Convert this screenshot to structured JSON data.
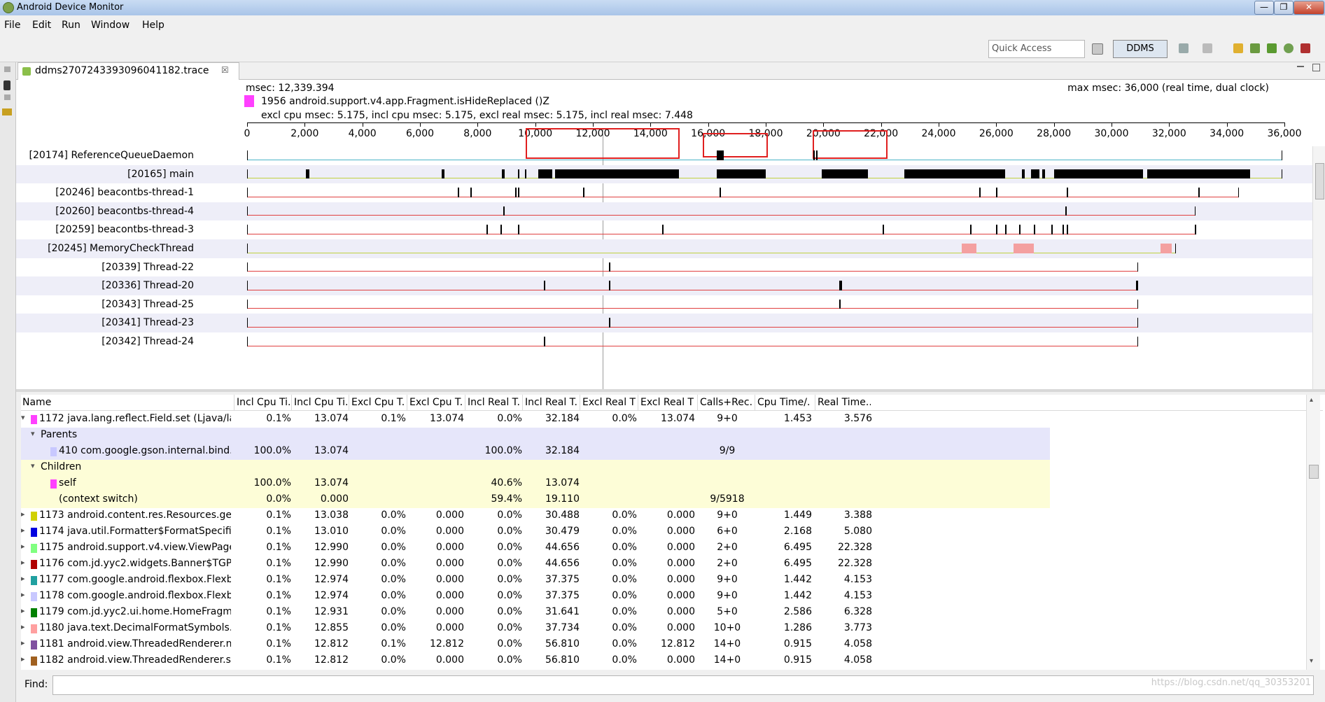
{
  "window": {
    "title": "Android Device Monitor",
    "controls": {
      "minimize": "—",
      "maximize": "❐",
      "close": "✕"
    }
  },
  "menu": [
    "File",
    "Edit",
    "Run",
    "Window",
    "Help"
  ],
  "toolbar": {
    "quick_access": "Quick Access",
    "perspective": "DDMS"
  },
  "tab": {
    "label": "ddms2707243393096041182.trace",
    "close": "☒"
  },
  "timeline": {
    "msec": "msec: 12,339.394",
    "max_msec": "max msec: 36,000 (real time, dual clock)",
    "method": "1956 android.support.v4.app.Fragment.isHideReplaced ()Z",
    "method_color": "#ff40ff",
    "detail": "excl cpu msec: 5.175, incl cpu msec: 5.175, excl real msec: 5.175, incl real msec: 7.448",
    "axis": {
      "range": [
        0,
        36000
      ],
      "ticks": [
        "0",
        "2,000",
        "4,000",
        "6,000",
        "8,000",
        "10,000",
        "12,000",
        "14,000",
        "16,000",
        "18,000",
        "20,000",
        "22,000",
        "24,000",
        "26,000",
        "28,000",
        "30,000",
        "32,000",
        "34,000",
        "36,000"
      ]
    },
    "cursor_msec": 12339,
    "threads": [
      {
        "name": "[20174] ReferenceQueueDaemon",
        "start": 0,
        "end": 35900,
        "line_color": "#4ab4c8",
        "marks": [
          [
            16300,
            16550
          ],
          [
            19650,
            19700
          ],
          [
            19750,
            19800
          ]
        ]
      },
      {
        "name": "[20165] main",
        "start": 0,
        "end": 35900,
        "line_color": "#c0d040",
        "marks": [
          [
            2050,
            2150
          ],
          [
            6750,
            6850
          ],
          [
            8850,
            8950
          ],
          [
            9400,
            9450
          ],
          [
            9650,
            9700
          ],
          [
            10100,
            10600
          ],
          [
            10700,
            15000
          ],
          [
            16300,
            18000
          ],
          [
            19950,
            21550
          ],
          [
            22800,
            26300
          ],
          [
            26900,
            27000
          ],
          [
            27200,
            27500
          ],
          [
            27600,
            27700
          ],
          [
            28000,
            31100
          ],
          [
            31250,
            34800
          ]
        ]
      },
      {
        "name": "[20246] beacontbs-thread-1",
        "start": 0,
        "end": 34400,
        "line_color": "#e04040",
        "marks": [
          [
            7300,
            7350
          ],
          [
            7750,
            7800
          ],
          [
            9300,
            9350
          ],
          [
            9400,
            9450
          ],
          [
            11650,
            11700
          ],
          [
            16400,
            16450
          ],
          [
            25400,
            25450
          ],
          [
            26000,
            26050
          ],
          [
            28450,
            28500
          ],
          [
            33000,
            33050
          ]
        ]
      },
      {
        "name": "[20260] beacontbs-thread-4",
        "start": 0,
        "end": 32900,
        "line_color": "#e04040",
        "marks": [
          [
            8900,
            8950
          ],
          [
            28400,
            28450
          ]
        ]
      },
      {
        "name": "[20259] beacontbs-thread-3",
        "start": 0,
        "end": 32900,
        "line_color": "#e04040",
        "marks": [
          [
            8300,
            8350
          ],
          [
            8800,
            8850
          ],
          [
            9400,
            9450
          ],
          [
            14400,
            14450
          ],
          [
            22050,
            22100
          ],
          [
            25100,
            25150
          ],
          [
            26000,
            26050
          ],
          [
            26300,
            26350
          ],
          [
            26800,
            26850
          ],
          [
            27300,
            27350
          ],
          [
            27900,
            27950
          ],
          [
            28300,
            28350
          ],
          [
            28450,
            28500
          ],
          [
            32900,
            32950
          ]
        ]
      },
      {
        "name": "[20245] MemoryCheckThread",
        "start": 0,
        "end": 32200,
        "line_color": "#c0d040",
        "marks": [
          [
            24800,
            25300
          ],
          [
            26600,
            27300
          ],
          [
            31700,
            32100
          ]
        ]
      },
      {
        "name": "[20339] Thread-22",
        "start": 0,
        "end": 30900,
        "line_color": "#e04040",
        "marks": [
          [
            12550,
            12600
          ]
        ]
      },
      {
        "name": "[20336] Thread-20",
        "start": 0,
        "end": 30900,
        "line_color": "#e04040",
        "marks": [
          [
            10300,
            10350
          ],
          [
            12550,
            12600
          ],
          [
            20550,
            20650
          ],
          [
            30850,
            30900
          ]
        ]
      },
      {
        "name": "[20343] Thread-25",
        "start": 0,
        "end": 30900,
        "line_color": "#e04040",
        "marks": [
          [
            20550,
            20600
          ]
        ]
      },
      {
        "name": "[20341] Thread-23",
        "start": 0,
        "end": 30900,
        "line_color": "#e04040",
        "marks": [
          [
            12550,
            12600
          ]
        ]
      },
      {
        "name": "[20342] Thread-24",
        "start": 0,
        "end": 30900,
        "line_color": "#e04040",
        "marks": [
          [
            10300,
            10350
          ]
        ]
      }
    ]
  },
  "table": {
    "columns": [
      "Name",
      "Incl Cpu Ti...",
      "Incl Cpu Ti...",
      "Excl Cpu T...",
      "Excl Cpu T...",
      "Incl Real T...",
      "Incl Real T...",
      "Excl Real T...",
      "Excl Real T...",
      "Calls+Rec...",
      "Cpu Time/...",
      "Real Time..."
    ],
    "rows": [
      {
        "kind": "method",
        "twist": "▾",
        "color": "#ff40ff",
        "cells": [
          "1172 java.lang.reflect.Field.set (Ljava/lang/Obj",
          "0.1%",
          "13.074",
          "0.1%",
          "13.074",
          "0.0%",
          "32.184",
          "0.0%",
          "13.074",
          "9+0",
          "1.453",
          "3.576"
        ]
      },
      {
        "kind": "parents",
        "twist": "▾",
        "color": "",
        "cells": [
          "Parents",
          "",
          "",
          "",
          "",
          "",
          "",
          "",
          "",
          "",
          "",
          ""
        ]
      },
      {
        "kind": "parents",
        "twist": "",
        "color": "#c8c8ff",
        "cells": [
          "410 com.google.gson.internal.bind.Refle",
          "100.0%",
          "13.074",
          "",
          "",
          "100.0%",
          "32.184",
          "",
          "",
          "9/9",
          "",
          ""
        ]
      },
      {
        "kind": "children",
        "twist": "▾",
        "color": "",
        "cells": [
          "Children",
          "",
          "",
          "",
          "",
          "",
          "",
          "",
          "",
          "",
          "",
          ""
        ]
      },
      {
        "kind": "children",
        "twist": "",
        "color": "#ff40ff",
        "cells": [
          "self",
          "100.0%",
          "13.074",
          "",
          "",
          "40.6%",
          "13.074",
          "",
          "",
          "",
          "",
          ""
        ]
      },
      {
        "kind": "children",
        "twist": "",
        "color": "",
        "cells": [
          "(context switch)",
          "0.0%",
          "0.000",
          "",
          "",
          "59.4%",
          "19.110",
          "",
          "",
          "9/5918",
          "",
          ""
        ]
      },
      {
        "kind": "method",
        "twist": "▸",
        "color": "#d0d000",
        "cells": [
          "1173 android.content.res.Resources.getAnima",
          "0.1%",
          "13.038",
          "0.0%",
          "0.000",
          "0.0%",
          "30.488",
          "0.0%",
          "0.000",
          "9+0",
          "1.449",
          "3.388"
        ]
      },
      {
        "kind": "method",
        "twist": "▸",
        "color": "#0000e0",
        "cells": [
          "1174 java.util.Formatter$FormatSpecifier.<init",
          "0.1%",
          "13.010",
          "0.0%",
          "0.000",
          "0.0%",
          "30.479",
          "0.0%",
          "0.000",
          "6+0",
          "2.168",
          "5.080"
        ]
      },
      {
        "kind": "method",
        "twist": "▸",
        "color": "#80ff80",
        "cells": [
          "1175 android.support.v4.view.ViewPager.addN",
          "0.1%",
          "12.990",
          "0.0%",
          "0.000",
          "0.0%",
          "44.656",
          "0.0%",
          "0.000",
          "2+0",
          "6.495",
          "22.328"
        ]
      },
      {
        "kind": "method",
        "twist": "▸",
        "color": "#b00000",
        "cells": [
          "1176 com.jd.yyc2.widgets.Banner$TGPageAda",
          "0.1%",
          "12.990",
          "0.0%",
          "0.000",
          "0.0%",
          "44.656",
          "0.0%",
          "0.000",
          "2+0",
          "6.495",
          "22.328"
        ]
      },
      {
        "kind": "method",
        "twist": "▸",
        "color": "#20a0a0",
        "cells": [
          "1177 com.google.android.flexbox.FlexboxHel",
          "0.1%",
          "12.974",
          "0.0%",
          "0.000",
          "0.0%",
          "37.375",
          "0.0%",
          "0.000",
          "9+0",
          "1.442",
          "4.153"
        ]
      },
      {
        "kind": "method",
        "twist": "▸",
        "color": "#c8c8ff",
        "cells": [
          "1178 com.google.android.flexbox.FlexboxHel",
          "0.1%",
          "12.974",
          "0.0%",
          "0.000",
          "0.0%",
          "37.375",
          "0.0%",
          "0.000",
          "9+0",
          "1.442",
          "4.153"
        ]
      },
      {
        "kind": "method",
        "twist": "▸",
        "color": "#008000",
        "cells": [
          "1179 com.jd.yyc2.ui.home.HomeFragment.upc",
          "0.1%",
          "12.931",
          "0.0%",
          "0.000",
          "0.0%",
          "31.641",
          "0.0%",
          "0.000",
          "5+0",
          "2.586",
          "6.328"
        ]
      },
      {
        "kind": "method",
        "twist": "▸",
        "color": "#ffa0a0",
        "cells": [
          "1180 java.text.DecimalFormatSymbols.setCurr",
          "0.1%",
          "12.855",
          "0.0%",
          "0.000",
          "0.0%",
          "37.734",
          "0.0%",
          "0.000",
          "10+0",
          "1.286",
          "3.773"
        ]
      },
      {
        "kind": "method",
        "twist": "▸",
        "color": "#8050a0",
        "cells": [
          "1181 android.view.ThreadedRenderer.nSetStc",
          "0.1%",
          "12.812",
          "0.1%",
          "12.812",
          "0.0%",
          "56.810",
          "0.0%",
          "12.812",
          "14+0",
          "0.915",
          "4.058"
        ]
      },
      {
        "kind": "method",
        "twist": "▸",
        "color": "#a06020",
        "cells": [
          "1182 android.view.ThreadedRenderer.setStop",
          "0.1%",
          "12.812",
          "0.0%",
          "0.000",
          "0.0%",
          "56.810",
          "0.0%",
          "0.000",
          "14+0",
          "0.915",
          "4.058"
        ]
      }
    ]
  },
  "find": {
    "label": "Find:",
    "value": ""
  },
  "watermark": "https://blog.csdn.net/qq_30353201"
}
